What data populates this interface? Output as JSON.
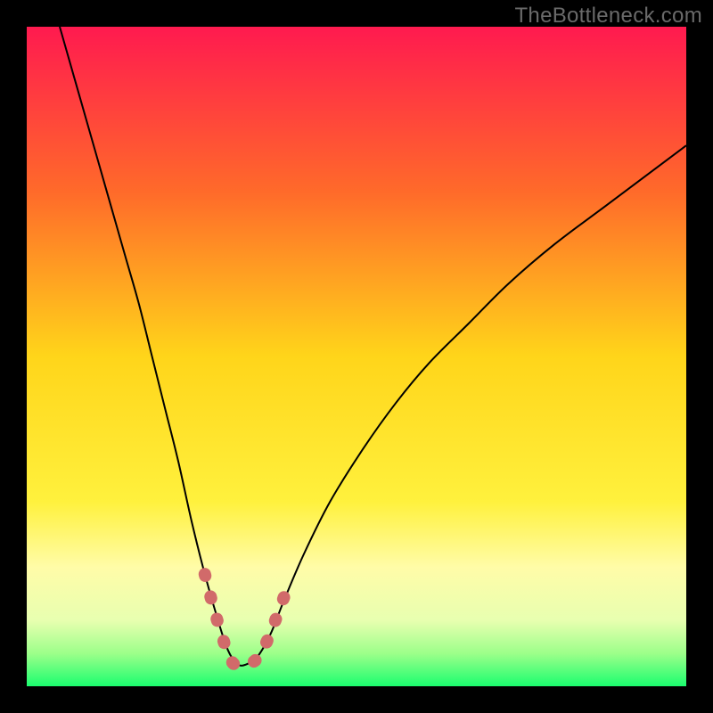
{
  "watermark": "TheBottleneck.com",
  "chart_data": {
    "type": "line",
    "title": "",
    "xlabel": "",
    "ylabel": "",
    "xlim": [
      0,
      100
    ],
    "ylim": [
      0,
      100
    ],
    "gradient_stops": [
      {
        "pos": 0.0,
        "color": "#ff1a4f"
      },
      {
        "pos": 0.25,
        "color": "#ff6a2a"
      },
      {
        "pos": 0.5,
        "color": "#ffd51a"
      },
      {
        "pos": 0.72,
        "color": "#fff13d"
      },
      {
        "pos": 0.82,
        "color": "#fffca8"
      },
      {
        "pos": 0.9,
        "color": "#e8ffb0"
      },
      {
        "pos": 0.95,
        "color": "#9dff8a"
      },
      {
        "pos": 1.0,
        "color": "#1bfd6f"
      }
    ],
    "series": [
      {
        "name": "curve",
        "x": [
          5,
          7,
          9,
          11,
          13,
          15,
          17,
          19,
          21,
          23,
          25,
          27,
          29,
          30.5,
          32,
          33.5,
          35,
          37,
          39,
          42,
          46,
          51,
          56,
          61,
          67,
          73,
          80,
          88,
          96,
          100
        ],
        "y": [
          100,
          93,
          86,
          79,
          72,
          65,
          58,
          50,
          42,
          34,
          25,
          17,
          10,
          5.5,
          3.3,
          3.4,
          4.5,
          8,
          13,
          20,
          28,
          36,
          43,
          49,
          55,
          61,
          67,
          73,
          79,
          82
        ],
        "stroke": "#000000",
        "stroke_width": 2
      },
      {
        "name": "highlight",
        "x": [
          27,
          28.3,
          29.5,
          30.5,
          31.5,
          33.0,
          34.5,
          35.5,
          36.5,
          37.7,
          39
        ],
        "y": [
          17,
          12,
          8,
          5,
          3.3,
          3.3,
          3.8,
          5,
          7,
          10,
          13.5
        ],
        "stroke": "#d16a6a",
        "stroke_width": 14,
        "dash": "2 24",
        "linecap": "round"
      }
    ]
  }
}
